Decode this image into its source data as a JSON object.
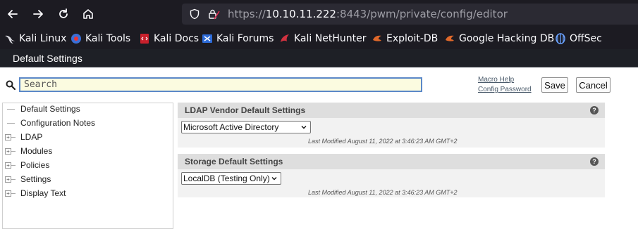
{
  "browser": {
    "url_prefix": "https://",
    "url_host": "10.10.11.222",
    "url_rest": ":8443/pwm/private/config/editor"
  },
  "bookmarks": [
    {
      "label": "Kali Linux",
      "icon": "kali-dragon-icon"
    },
    {
      "label": "Kali Tools",
      "icon": "kali-tools-icon"
    },
    {
      "label": "Kali Docs",
      "icon": "kali-docs-icon"
    },
    {
      "label": "Kali Forums",
      "icon": "kali-forums-icon"
    },
    {
      "label": "Kali NetHunter",
      "icon": "nethunter-icon"
    },
    {
      "label": "Exploit-DB",
      "icon": "exploitdb-icon"
    },
    {
      "label": "Google Hacking DB",
      "icon": "ghdb-icon"
    },
    {
      "label": "OffSec",
      "icon": "offsec-icon"
    }
  ],
  "app": {
    "title": "Default Settings"
  },
  "toolbar": {
    "search_placeholder": "Search",
    "macro_help": "Macro Help",
    "config_password": "Config Password",
    "save": "Save",
    "cancel": "Cancel"
  },
  "tree": {
    "items": [
      {
        "label": "Default Settings",
        "expandable": false
      },
      {
        "label": "Configuration Notes",
        "expandable": false
      },
      {
        "label": "LDAP",
        "expandable": true
      },
      {
        "label": "Modules",
        "expandable": true
      },
      {
        "label": "Policies",
        "expandable": true
      },
      {
        "label": "Settings",
        "expandable": true
      },
      {
        "label": "Display Text",
        "expandable": true
      }
    ]
  },
  "panels": [
    {
      "title": "LDAP Vendor Default Settings",
      "selected": "Microsoft Active Directory",
      "modified": "Last Modified August 11, 2022 at 3:46:23 AM GMT+2"
    },
    {
      "title": "Storage Default Settings",
      "selected": "LocalDB (Testing Only)",
      "modified": "Last Modified August 11, 2022 at 3:46:23 AM GMT+2"
    }
  ],
  "colors": {
    "chrome_bg": "#1c1b22",
    "search_bg": "#fbfbe0",
    "search_border": "#5b88c8"
  }
}
